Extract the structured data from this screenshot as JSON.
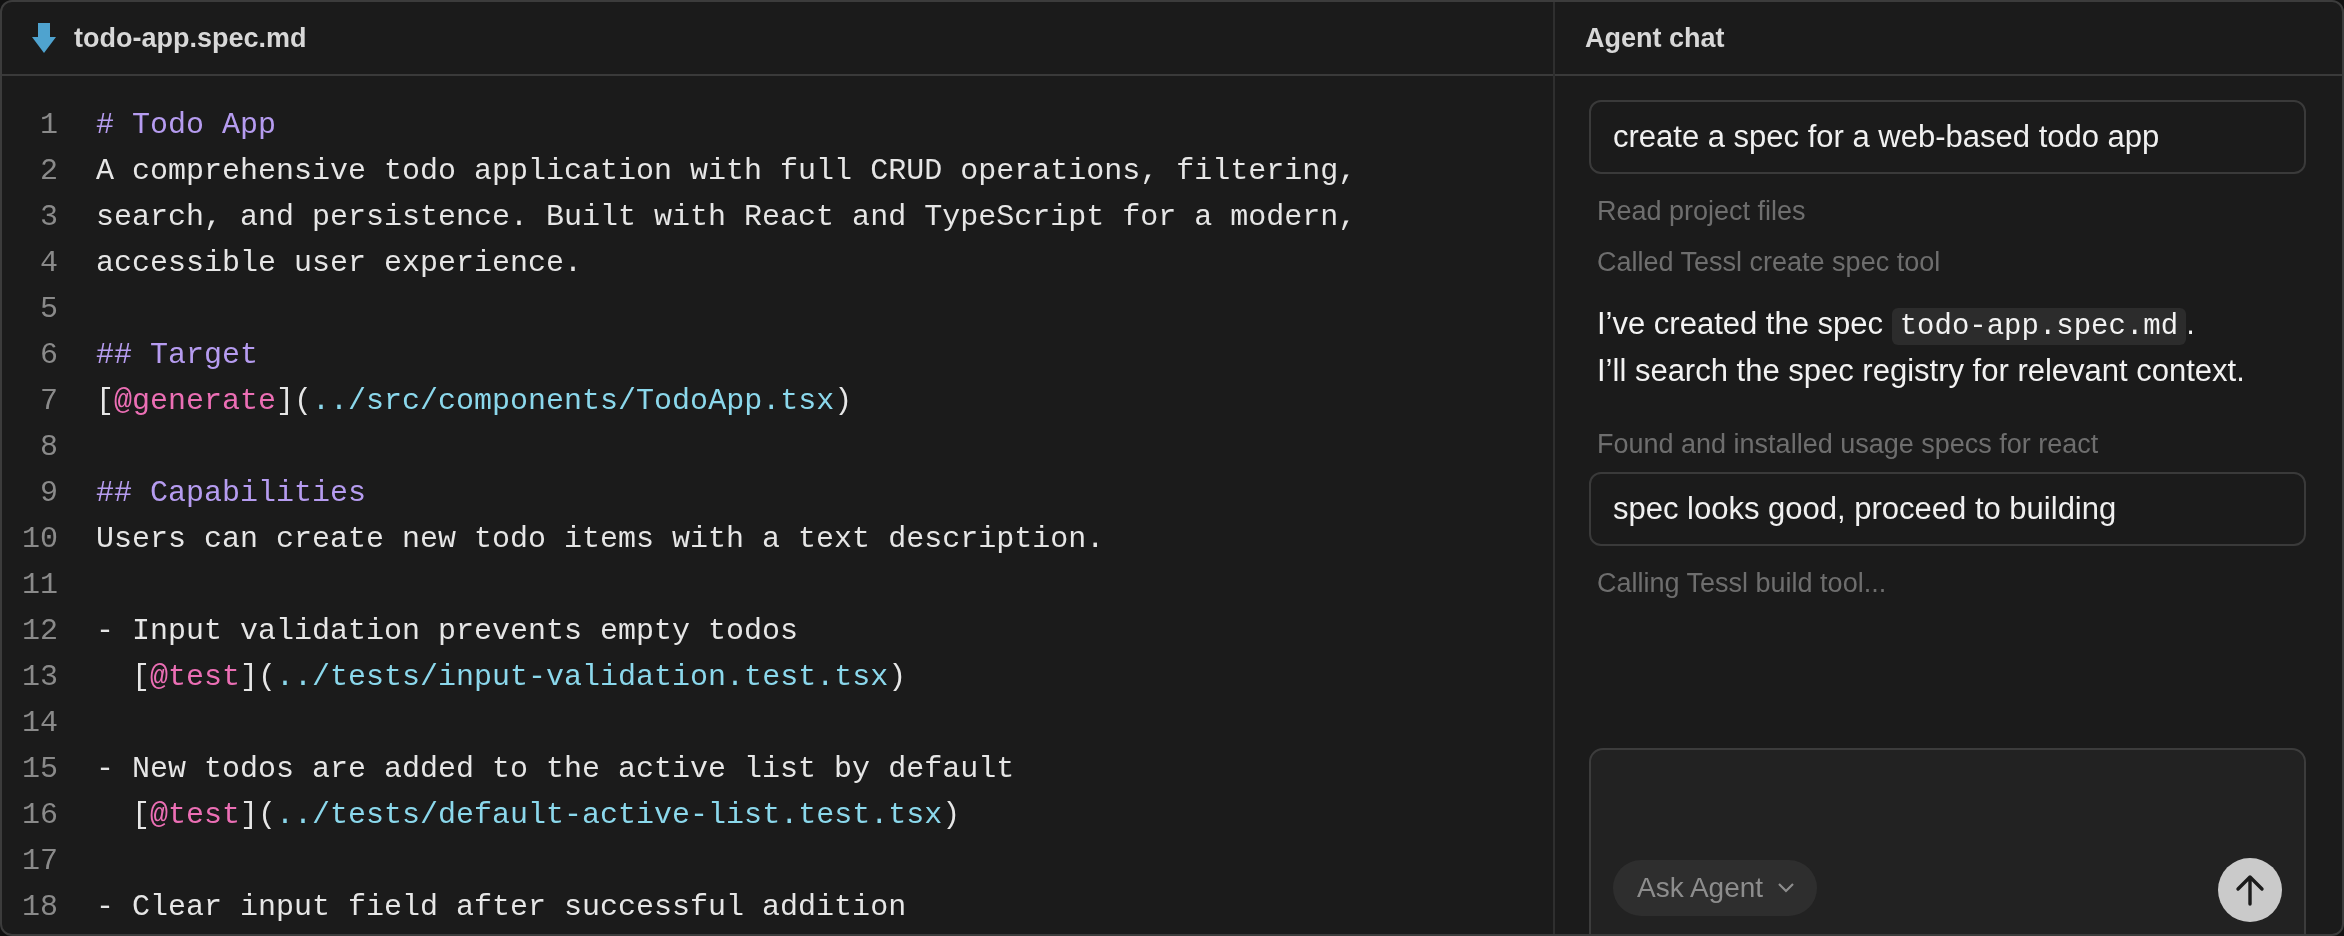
{
  "editor": {
    "file_name": "todo-app.spec.md",
    "lines": [
      {
        "number": "1",
        "segments": [
          {
            "kind": "heading",
            "text": "# Todo App"
          }
        ]
      },
      {
        "number": "2",
        "segments": [
          {
            "kind": "text",
            "text": "A comprehensive todo application with full CRUD operations, filtering,"
          }
        ]
      },
      {
        "number": "3",
        "segments": [
          {
            "kind": "text",
            "text": "search, and persistence. Built with React and TypeScript for a modern,"
          }
        ]
      },
      {
        "number": "4",
        "segments": [
          {
            "kind": "text",
            "text": "accessible user experience."
          }
        ]
      },
      {
        "number": "5"
      },
      {
        "number": "6",
        "segments": [
          {
            "kind": "heading",
            "text": "## Target"
          }
        ]
      },
      {
        "number": "7",
        "segments": [
          {
            "kind": "text",
            "text": "["
          },
          {
            "kind": "tag",
            "text": "@generate"
          },
          {
            "kind": "text",
            "text": "]("
          },
          {
            "kind": "link",
            "text": "../src/components/TodoApp.tsx"
          },
          {
            "kind": "text",
            "text": ")"
          }
        ]
      },
      {
        "number": "8"
      },
      {
        "number": "9",
        "segments": [
          {
            "kind": "heading",
            "text": "## Capabilities"
          }
        ]
      },
      {
        "number": "10",
        "segments": [
          {
            "kind": "text",
            "text": "Users can create new todo items with a text description."
          }
        ]
      },
      {
        "number": "11"
      },
      {
        "number": "12",
        "segments": [
          {
            "kind": "text",
            "text": "- Input validation prevents empty todos"
          }
        ]
      },
      {
        "number": "13",
        "segments": [
          {
            "kind": "text",
            "text": "  ["
          },
          {
            "kind": "tag",
            "text": "@test"
          },
          {
            "kind": "text",
            "text": "]("
          },
          {
            "kind": "link",
            "text": "../tests/input-validation.test.tsx"
          },
          {
            "kind": "text",
            "text": ")"
          }
        ]
      },
      {
        "number": "14"
      },
      {
        "number": "15",
        "segments": [
          {
            "kind": "text",
            "text": "- New todos are added to the active list by default"
          }
        ]
      },
      {
        "number": "16",
        "segments": [
          {
            "kind": "text",
            "text": "  ["
          },
          {
            "kind": "tag",
            "text": "@test"
          },
          {
            "kind": "text",
            "text": "]("
          },
          {
            "kind": "link",
            "text": "../tests/default-active-list.test.tsx"
          },
          {
            "kind": "text",
            "text": ")"
          }
        ]
      },
      {
        "number": "17"
      },
      {
        "number": "18",
        "segments": [
          {
            "kind": "text",
            "text": "- Clear input field after successful addition"
          }
        ]
      }
    ]
  },
  "chat": {
    "title": "Agent chat",
    "messages": [
      {
        "kind": "user",
        "text": "create a spec for a web-based todo app"
      },
      {
        "kind": "status",
        "text": "Read project files"
      },
      {
        "kind": "status",
        "text": "Called Tessl create spec tool"
      },
      {
        "kind": "agent",
        "lines": [
          [
            {
              "kind": "text",
              "text": "I’ve created the spec "
            },
            {
              "kind": "code",
              "text": "todo-app.spec.md"
            },
            {
              "kind": "text",
              "text": "."
            }
          ],
          [
            {
              "kind": "text",
              "text": "I’ll search the spec registry for relevant context."
            }
          ]
        ]
      },
      {
        "kind": "status",
        "text": "Found and installed usage specs for react"
      },
      {
        "kind": "user",
        "text": "spec looks good, proceed to building"
      },
      {
        "kind": "status",
        "text": "Calling Tessl build tool..."
      }
    ],
    "composer": {
      "mode": "Ask Agent"
    }
  }
}
